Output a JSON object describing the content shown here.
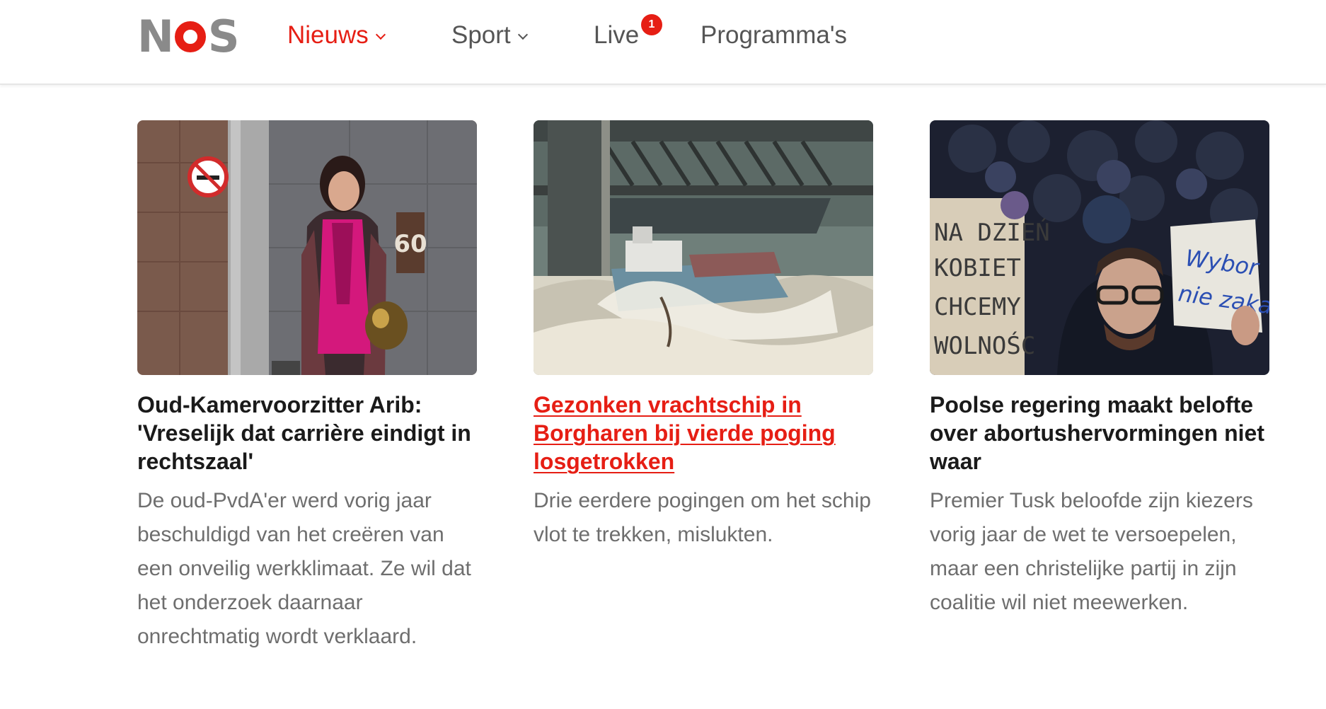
{
  "header": {
    "logo_letters": [
      "N",
      "S"
    ],
    "nav": [
      {
        "label": "Nieuws",
        "active": true,
        "dropdown": true
      },
      {
        "label": "Sport",
        "active": false,
        "dropdown": true
      },
      {
        "label": "Live",
        "active": false,
        "dropdown": false,
        "badge": "1"
      },
      {
        "label": "Programma's",
        "active": false,
        "dropdown": false
      }
    ]
  },
  "colors": {
    "brand_red": "#e61e14",
    "nav_gray": "#555555",
    "text_dark": "#1a1a1a",
    "summary_gray": "#6e6e6e"
  },
  "articles": [
    {
      "headline": "Oud-Kamervoorzitter Arib: 'Vreselijk dat carrière eindigt in rechtszaal'",
      "summary": "De oud-PvdA'er werd vorig jaar beschuldigd van het creëren van een onveilig werkklimaat. Ze wil dat het onderzoek daarnaar onrechtmatig wordt verklaard.",
      "image_text": "60",
      "hovered": false
    },
    {
      "headline": "Gezonken vrachtschip in Borgharen bij vierde poging losgetrokken",
      "summary": "Drie eerdere pogingen om het schip vlot te trekken, mislukten.",
      "hovered": true
    },
    {
      "headline": "Poolse regering maakt belofte over abortushervormingen niet waar",
      "summary": "Premier Tusk beloofde zijn kiezers vorig jaar de wet te versoepelen, maar een christelijke partij in zijn coalitie wil niet meewerken.",
      "sign_left": [
        "NA DZIEŃ",
        "KOBIET",
        "CHCEMY",
        "WOLNOŚC"
      ],
      "sign_right": [
        "Wybor",
        "nie zakaz"
      ],
      "hovered": false
    }
  ]
}
